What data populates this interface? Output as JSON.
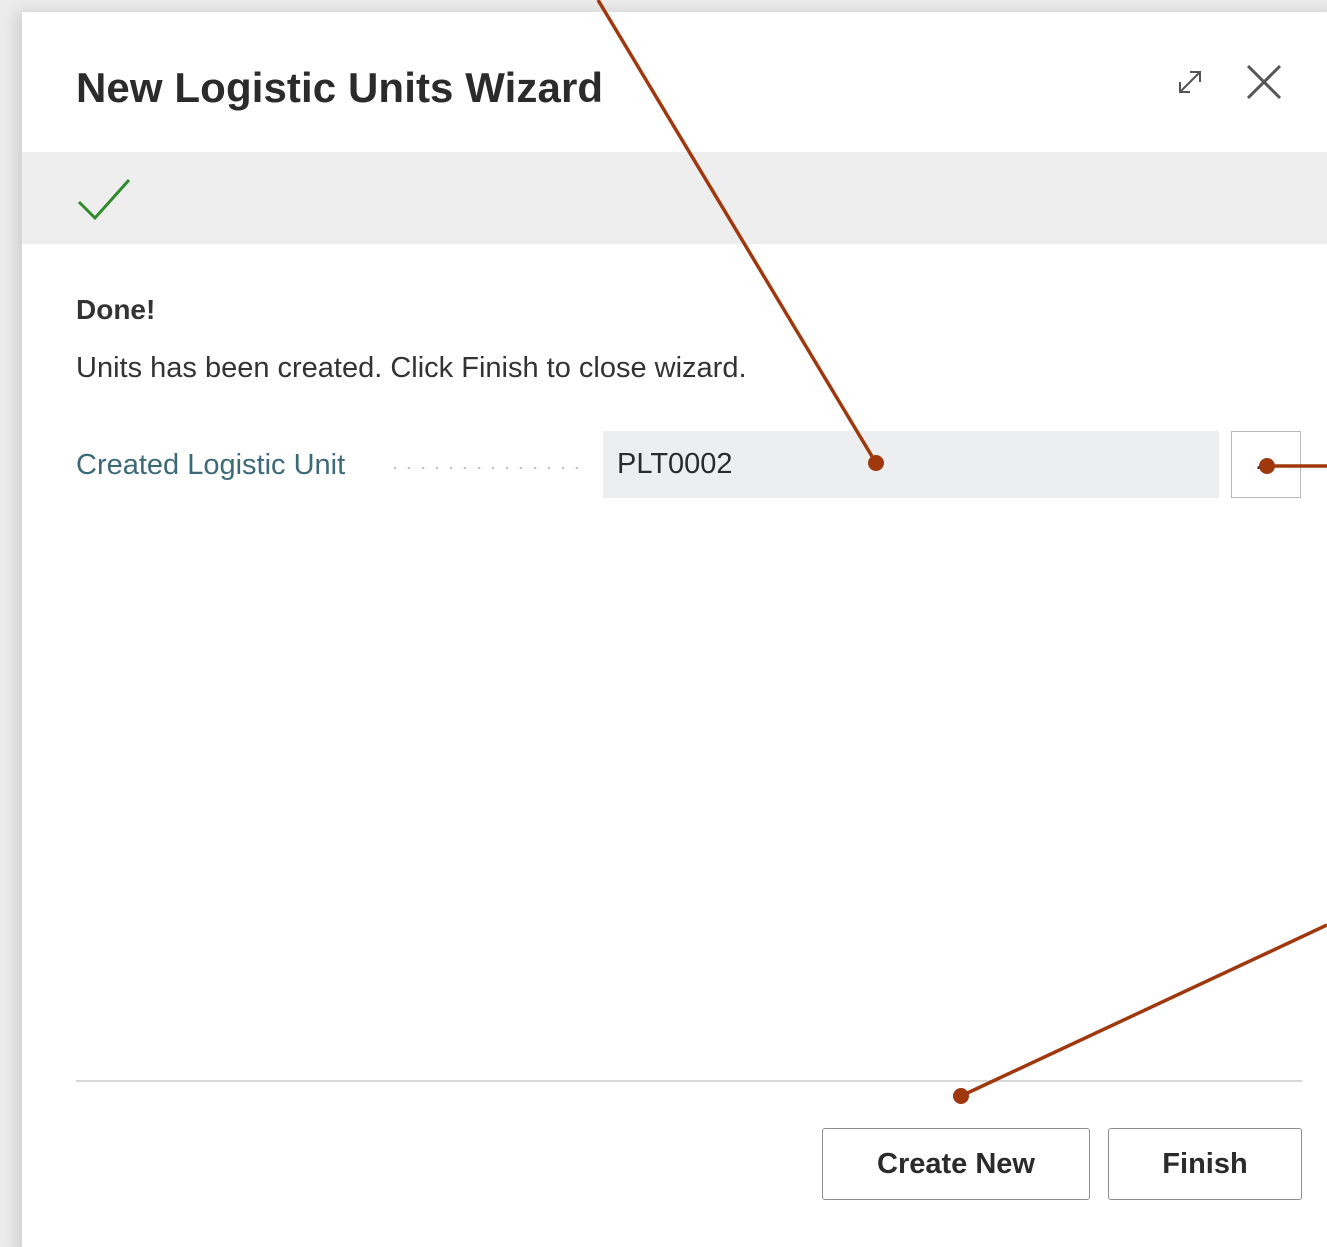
{
  "dialog": {
    "title": "New Logistic Units Wizard",
    "expand_icon": "expand-diagonal-icon",
    "close_icon": "close-x-icon"
  },
  "step": {
    "status_icon": "checkmark-icon",
    "status_color": "#2e8b2e"
  },
  "content": {
    "heading": "Done!",
    "message": "Units has been created. Click Finish to close wizard."
  },
  "field": {
    "label": "Created Logistic Unit",
    "value": "PLT0002",
    "lookup_label": "..."
  },
  "footer": {
    "create_new_label": "Create New",
    "finish_label": "Finish"
  },
  "annotation_color": "#a0380e"
}
